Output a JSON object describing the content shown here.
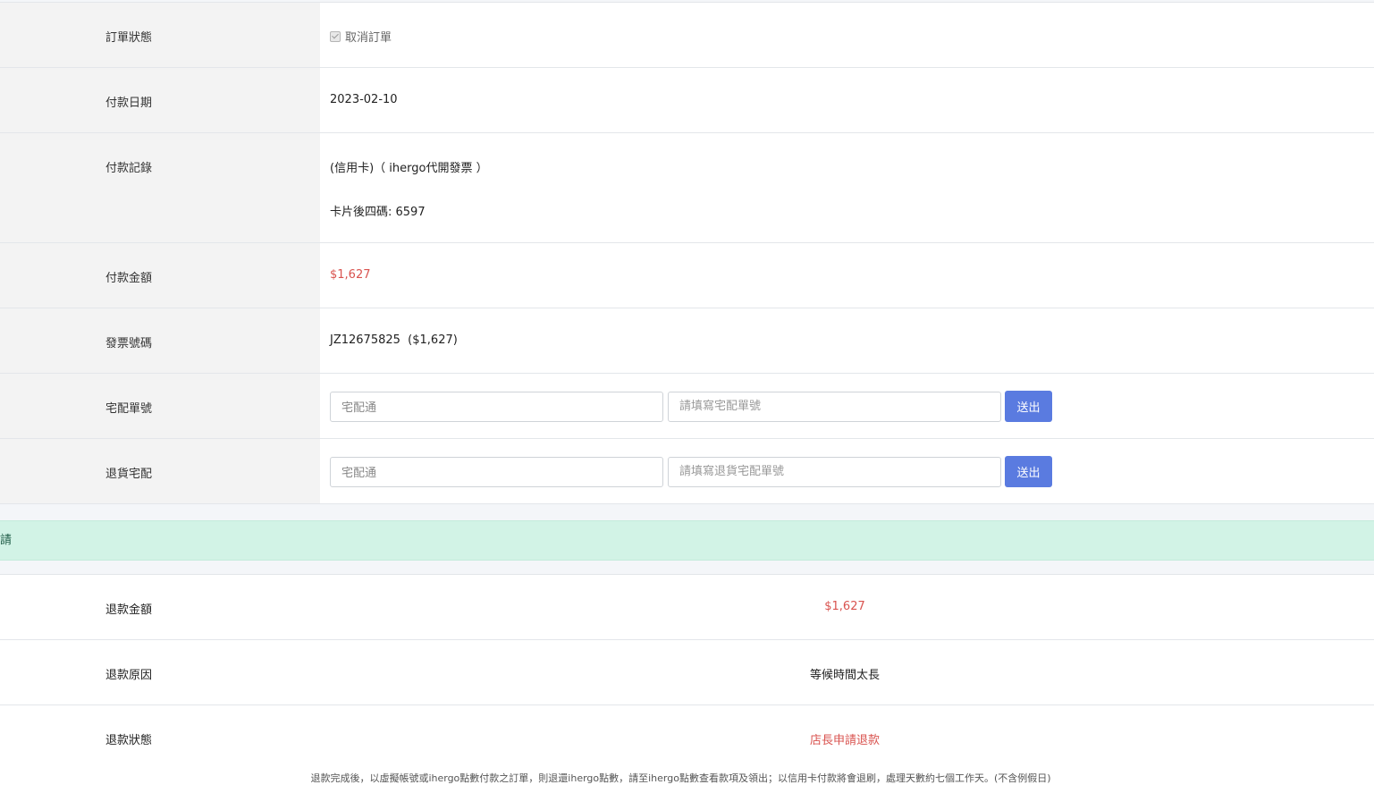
{
  "order": {
    "status": {
      "label": "訂單狀態",
      "checkbox_label": "取消訂單",
      "checked": true
    },
    "payment_date": {
      "label": "付款日期",
      "value": "2023-02-10"
    },
    "payment_record": {
      "label": "付款記錄",
      "line1": "(信用卡)（ ihergo代開發票 ）",
      "line2": "卡片後四碼: 6597"
    },
    "payment_amount": {
      "label": "付款金額",
      "value": "$1,627"
    },
    "invoice": {
      "label": "發票號碼",
      "value": "JZ12675825  ($1,627)"
    },
    "shipping": {
      "label": "宅配單號",
      "carrier_value": "宅配通",
      "tracking_placeholder": "請填寫宅配單號",
      "submit_label": "送出"
    },
    "return_shipping": {
      "label": "退貨宅配",
      "carrier_value": "宅配通",
      "tracking_placeholder": "請填寫退貨宅配單號",
      "submit_label": "送出"
    }
  },
  "refund_banner": {
    "text": "請"
  },
  "refund": {
    "amount": {
      "label": "退款金額",
      "value": "$1,627"
    },
    "reason": {
      "label": "退款原因",
      "value": "等候時間太長"
    },
    "status": {
      "label": "退款狀態",
      "value": "店長申請退款"
    },
    "note": "退款完成後，以虛擬帳號或ihergo點數付款之訂單，則退還ihergo點數，請至ihergo點數查看款項及領出；以信用卡付款將會退刷，處理天數約七個工作天。(不含例假日)"
  },
  "colors": {
    "accent": "#5a7be0",
    "price_red": "#d9534f",
    "banner_bg": "#d2f3e6"
  }
}
